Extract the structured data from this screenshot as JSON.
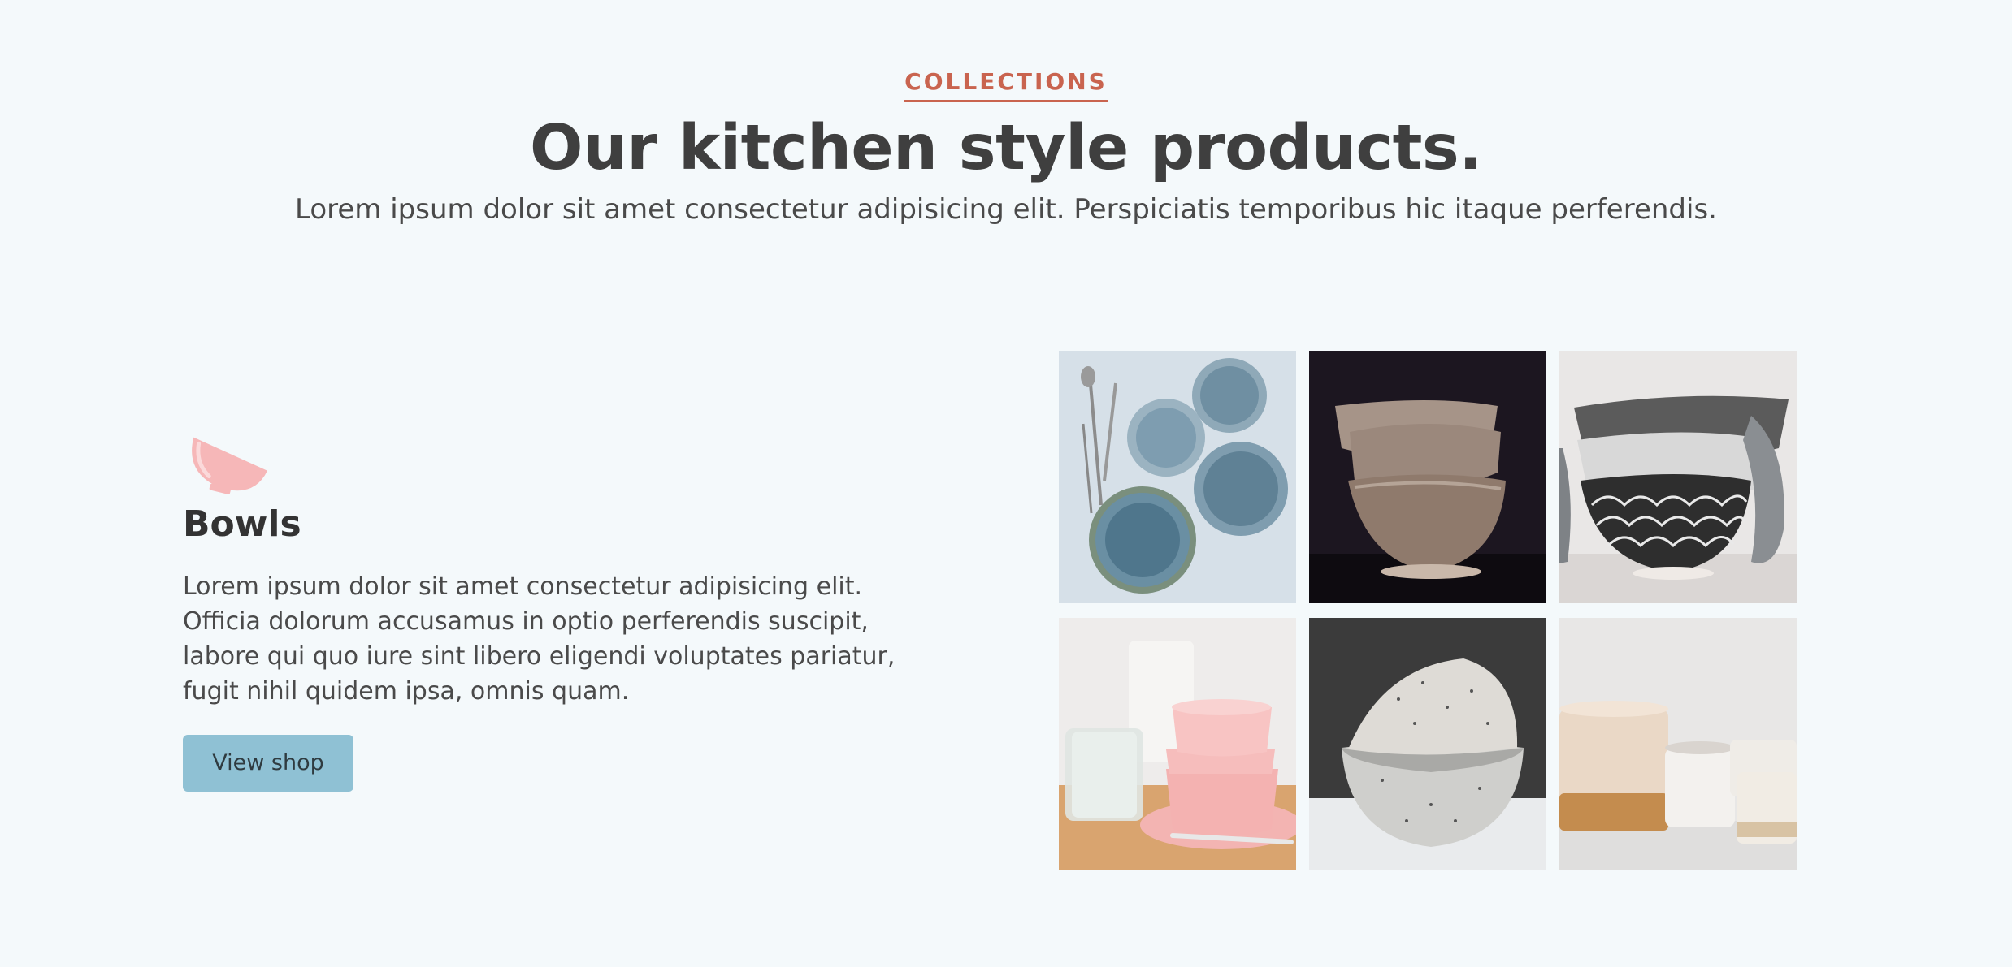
{
  "header": {
    "eyebrow": "COLLECTIONS",
    "title": "Our kitchen style products.",
    "subtitle": "Lorem ipsum dolor sit amet consectetur adipisicing elit. Perspiciatis temporibus hic itaque perferendis."
  },
  "feature": {
    "icon": "bowl-icon",
    "title": "Bowls",
    "description": "Lorem ipsum dolor sit amet consectetur adipisicing elit. Officia dolorum accusamus in optio perferendis suscipit, labore qui quo iure sint libero eligendi voluptates pariatur, fugit nihil quidem ipsa, omnis quam.",
    "button_label": "View shop"
  },
  "colors": {
    "background": "#f4f9fb",
    "accent": "#c9644f",
    "button": "#8fc1d4",
    "icon": "#f6b7b8"
  }
}
